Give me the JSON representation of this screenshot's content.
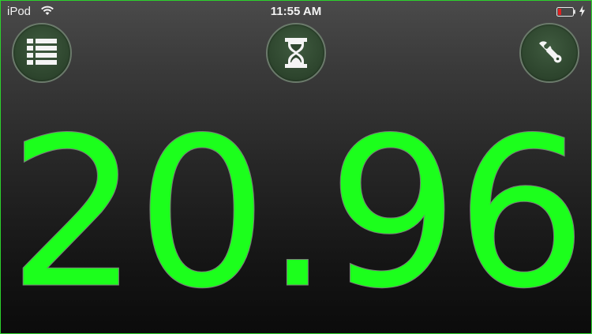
{
  "status_bar": {
    "carrier": "iPod",
    "time": "11:55 AM",
    "icons": [
      "wifi-icon",
      "battery-low-icon",
      "charging-bolt-icon"
    ],
    "battery_color": "#e02020"
  },
  "toolbar": {
    "left_button_icon": "list-icon",
    "center_button_icon": "hourglass-icon",
    "right_button_icon": "wrench-icon"
  },
  "display": {
    "value": "20.96",
    "color": "#1cff1c"
  },
  "theme": {
    "frame_border": "#2cd12c",
    "button_fill": "#2f472f",
    "button_border": "#6b7a6b"
  }
}
